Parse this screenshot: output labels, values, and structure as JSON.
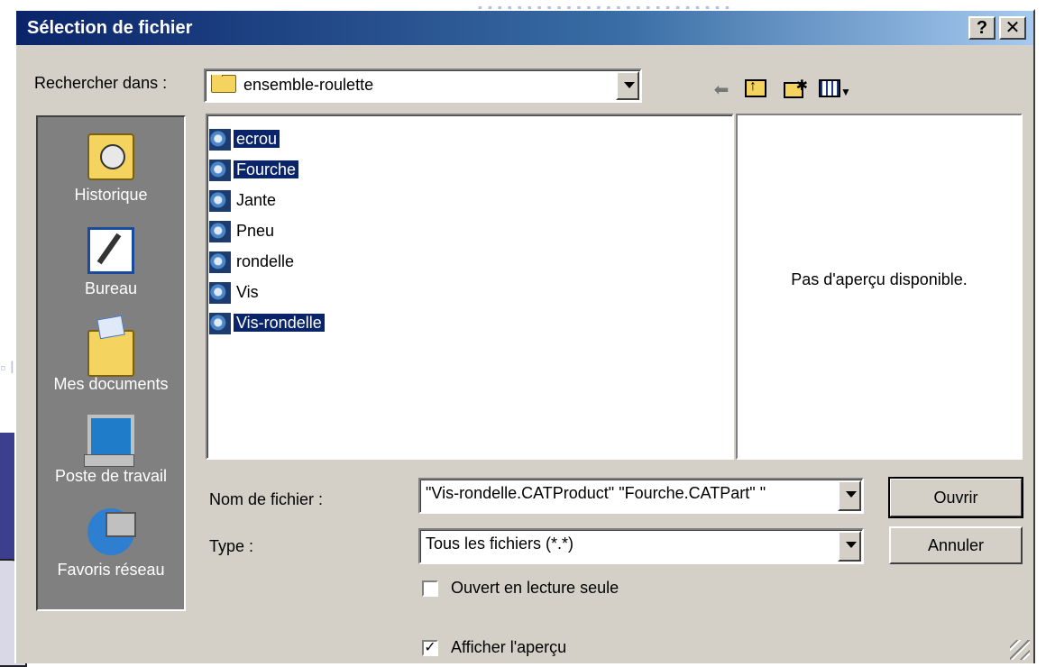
{
  "window": {
    "title": "Sélection de fichier",
    "help_label": "?",
    "close_label": "✕"
  },
  "look_in": {
    "label": "Rechercher dans :",
    "value": "ensemble-roulette"
  },
  "toolbar": {
    "back_icon": "back-arrow-icon",
    "up_icon": "up-folder-icon",
    "new_folder_icon": "new-folder-icon",
    "view_icon": "view-menu-icon"
  },
  "places": [
    {
      "label": "Historique",
      "icon": "history-icon"
    },
    {
      "label": "Bureau",
      "icon": "desktop-icon"
    },
    {
      "label": "Mes documents",
      "icon": "my-documents-icon"
    },
    {
      "label": "Poste de travail",
      "icon": "my-computer-icon"
    },
    {
      "label": "Favoris réseau",
      "icon": "network-places-icon"
    }
  ],
  "files": [
    {
      "name": "ecrou",
      "selected": true
    },
    {
      "name": "Fourche",
      "selected": true
    },
    {
      "name": "Jante",
      "selected": false
    },
    {
      "name": "Pneu",
      "selected": false
    },
    {
      "name": "rondelle",
      "selected": false
    },
    {
      "name": "Vis",
      "selected": false
    },
    {
      "name": "Vis-rondelle",
      "selected": true
    }
  ],
  "preview": {
    "message": "Pas d'aperçu disponible."
  },
  "filename": {
    "label": "Nom de fichier :",
    "value": "\"Vis-rondelle.CATProduct\" \"Fourche.CATPart\" \""
  },
  "filetype": {
    "label": "Type :",
    "value": "Tous les fichiers (*.*)"
  },
  "buttons": {
    "open": "Ouvrir",
    "cancel": "Annuler"
  },
  "readonly": {
    "label": "Ouvert en lecture seule",
    "checked": false
  },
  "show_preview": {
    "label": "Afficher l'aperçu",
    "checked": true
  },
  "colors": {
    "title_bar": "#0a246a",
    "selection": "#0a246a",
    "dialog_face": "#d4d0c8"
  }
}
